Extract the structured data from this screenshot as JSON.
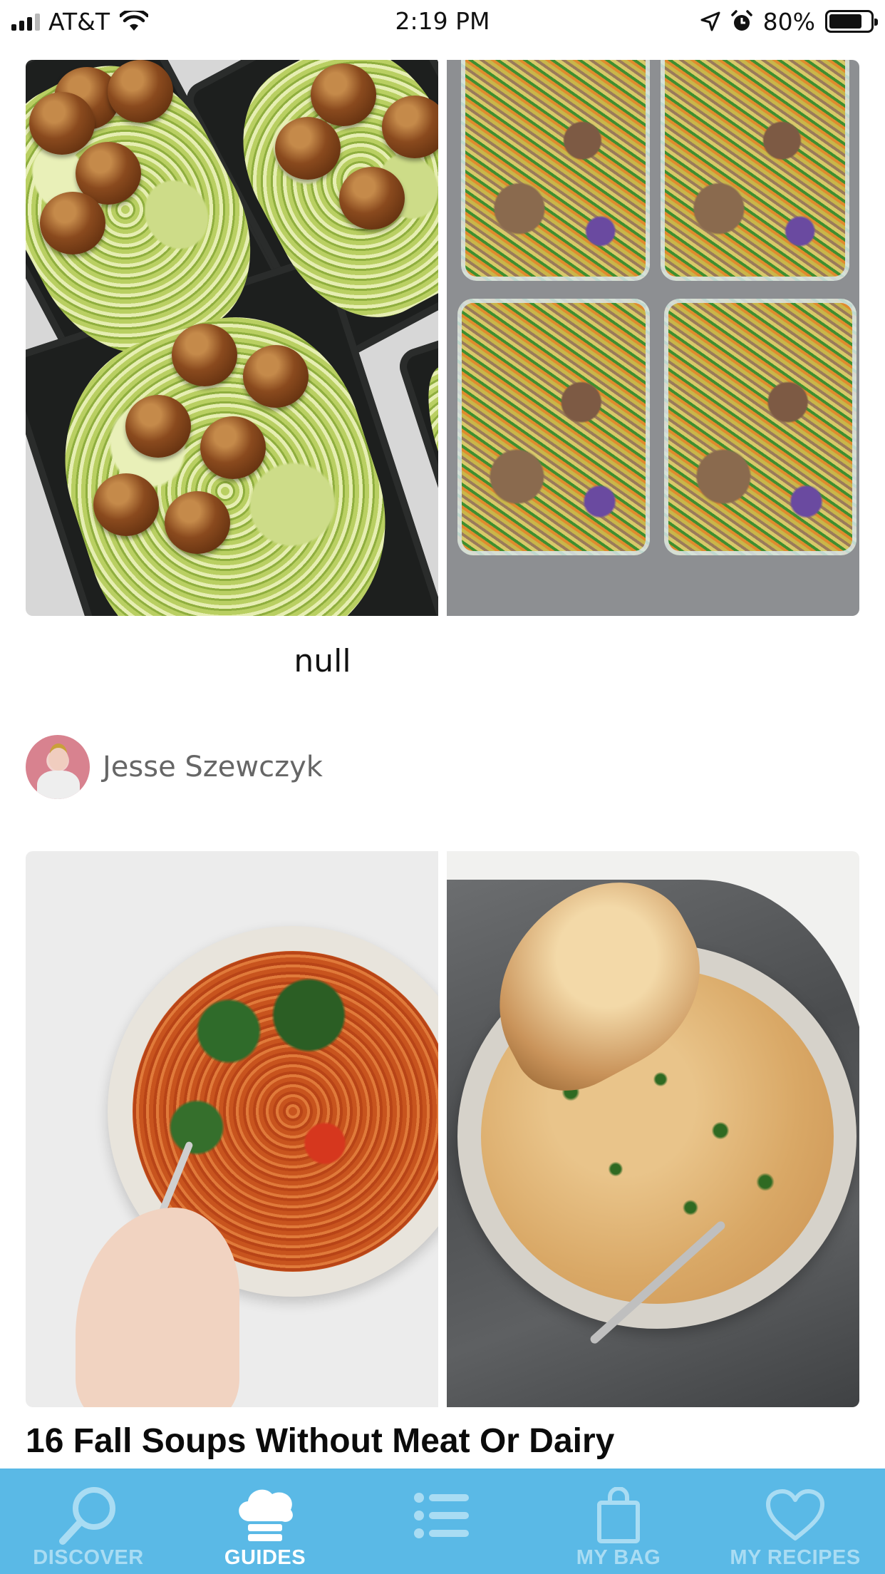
{
  "status_bar": {
    "carrier": "AT&T",
    "time": "2:19 PM",
    "battery_percent": "80%",
    "battery_level": 0.8,
    "icons": [
      "signal-icon",
      "wifi-icon",
      "location-arrow-icon",
      "alarm-icon",
      "battery-icon"
    ]
  },
  "feed": {
    "first_card_caption": "null",
    "author": {
      "name": "Jesse Szewczyk",
      "avatar_icon": "avatar"
    },
    "second_card_title": "16 Fall Soups Without Meat Or Dairy"
  },
  "tab_bar": {
    "background": "#5ab9e6",
    "active_color": "#ffffff",
    "inactive_color": "#a9dcf3",
    "tabs": [
      {
        "label": "DISCOVER",
        "icon": "search-icon",
        "active": false
      },
      {
        "label": "GUIDES",
        "icon": "chef-hat-icon",
        "active": true
      },
      {
        "label": "",
        "icon": "list-icon",
        "active": false
      },
      {
        "label": "MY BAG",
        "icon": "shopping-bag-icon",
        "active": false
      },
      {
        "label": "MY RECIPES",
        "icon": "heart-icon",
        "active": false
      }
    ]
  }
}
